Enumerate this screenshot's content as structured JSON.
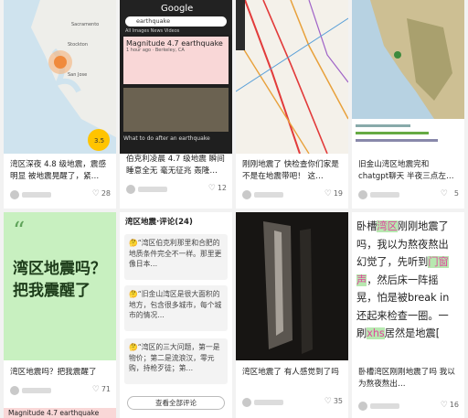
{
  "cards": [
    {
      "title": "湾区深夜 4.8 级地震，震感明显 被地震晃醒了，紧…",
      "likes": "28"
    },
    {
      "title": "伯克利凌晨 4.7 级地震 瞬间睡意全无 毫无征兆 轰隆…",
      "likes": "12",
      "google": {
        "logo": "Google",
        "query": "earthquake",
        "tabs": "All  Images  News  Videos",
        "result_title": "Magnitude 4.7 earthquake",
        "result_sub": "1 hour ago · Berkeley, CA",
        "what_to_do": "What to do after an earthquake"
      }
    },
    {
      "title": "刚刚地震了 快检查你们家是不是在地震带吧！ 这…",
      "likes": "19"
    },
    {
      "title": "旧金山湾区地震完和 chatgpt聊天 半夜三点左…",
      "likes": "5"
    },
    {
      "title": "湾区地震吗？把我震醒了",
      "likes": "71",
      "quote": "“",
      "big_text": "湾区地震吗？\n把我震醒了",
      "bottom_strip": "Magnitude 4.7 earthquake"
    },
    {
      "header": "湾区地震·评论(24)",
      "comments": [
        "🤔“湾区伯克利那里和合肥的地质条件完全不一样。那里更像日本…",
        "🤔“旧金山湾区是很大面积的地方，包含很多城市，每个城市的情况…",
        "🤔“湾区的三大问题，第一是物价；第二是流浪汉，零元购，持枪歹徒；第…"
      ],
      "button": "查看全部评论"
    },
    {
      "title": "湾区地震了 有人感觉到了吗",
      "likes": "35"
    },
    {
      "title": "卧槽湾区刚刚地震了吗 我以为熬夜熬出…",
      "likes": "16",
      "note": {
        "line1a": "卧槽",
        "line1b": "湾区",
        "line1c": "刚刚地震了",
        "line2": "吗，我以为熬夜熬出",
        "line3a": "幻觉了，先听到",
        "line3b": "门窗",
        "line4a": "声",
        "line4b": "，然后床一阵摇",
        "line5": "晃，怕是被break in",
        "line6": "还起来检查一圈。一",
        "line7a": "刷",
        "line7b": "xhs",
        "line7c": "居然是地震["
      }
    }
  ]
}
